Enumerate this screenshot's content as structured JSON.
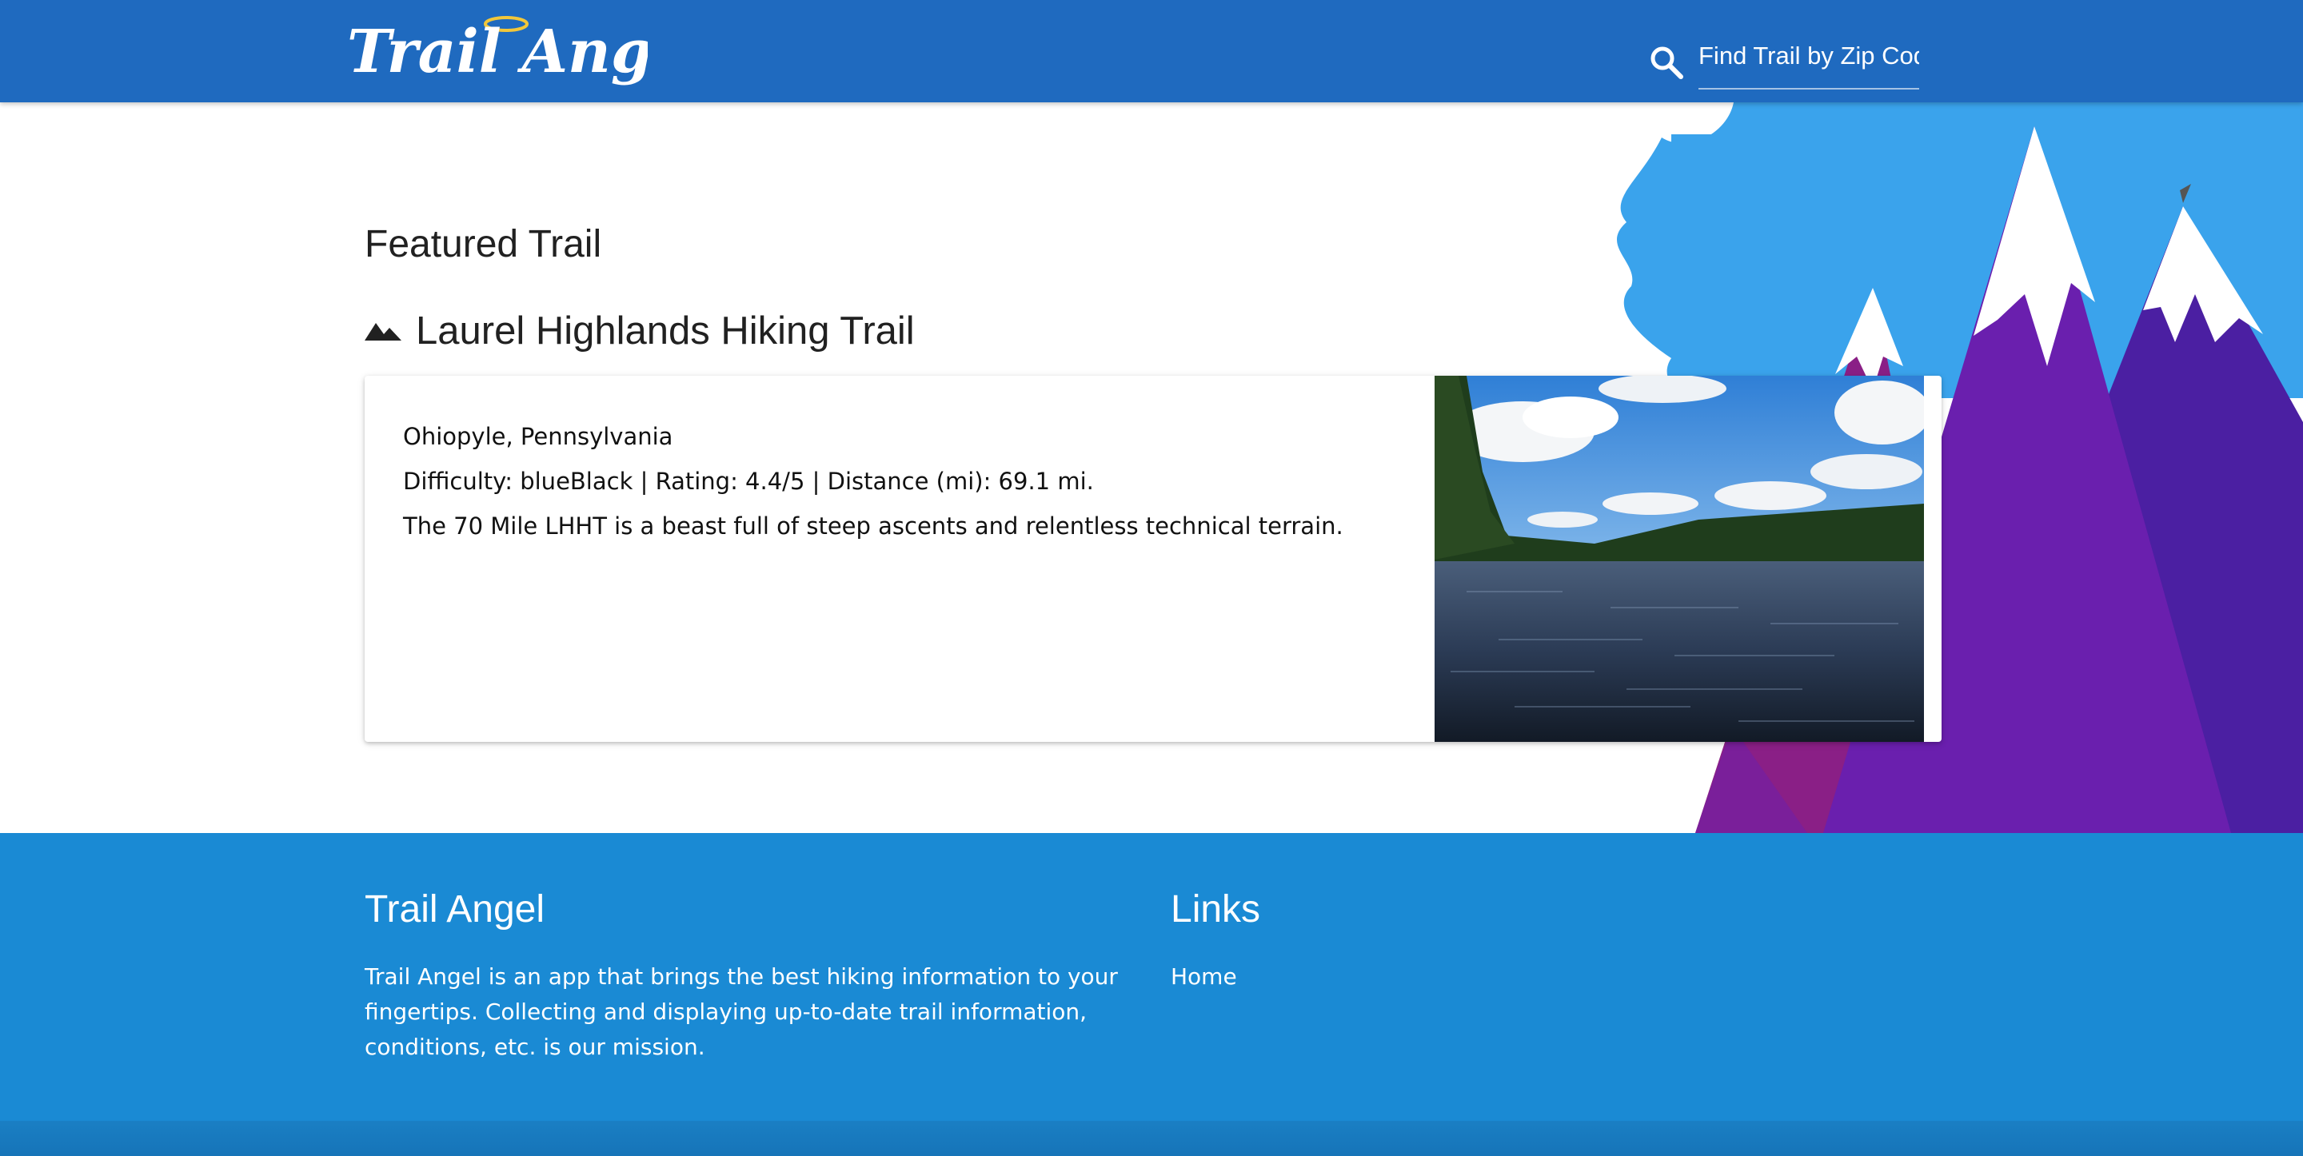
{
  "navbar": {
    "brand": "Trail Angel",
    "search_placeholder": "Find Trail by Zip Code",
    "search_value": ""
  },
  "featured": {
    "section_title": "Featured Trail",
    "trail_name": "Laurel Highlands Hiking Trail",
    "location": "Ohiopyle, Pennsylvania",
    "stats": "Difficulty: blueBlack | Rating: 4.4/5 | Distance (mi): 69.1 mi.",
    "description": "The 70 Mile LHHT is a beast full of steep ascents and relentless technical terrain."
  },
  "footer": {
    "about_title": "Trail Angel",
    "about_text": "Trail Angel is an app that brings the best hiking information to your fingertips. Collecting and displaying up-to-date trail information, conditions, etc. is our mission.",
    "links_title": "Links",
    "links": [
      {
        "label": "Home"
      }
    ]
  },
  "colors": {
    "navbar": "#1f6abf",
    "footer": "#1a8ad4",
    "sky": "#3aa3ec",
    "mountain_purple": "#6a1fae",
    "mountain_magenta": "#8a1f86",
    "logo_halo": "#f2c73a"
  },
  "icons": {
    "search": "search-icon",
    "mountain": "mountain-icon"
  }
}
